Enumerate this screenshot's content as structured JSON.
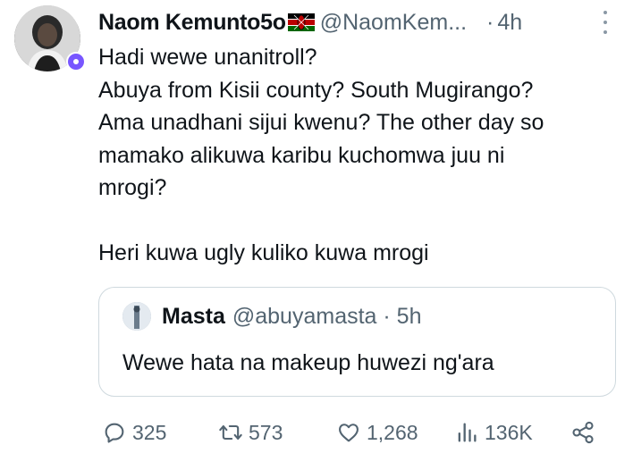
{
  "tweet": {
    "author_name": "Naom Kemunto5o",
    "author_handle": "@NaomKem...",
    "separator": "·",
    "time": "4h",
    "text_lines": [
      "Hadi wewe unanitroll?",
      "Abuya from Kisii county? South Mugirango?",
      "Ama unadhani sijui kwenu? The other day so",
      "mamako alikuwa karibu kuchomwa juu ni",
      "mrogi?",
      "",
      "Heri kuwa ugly kuliko kuwa mrogi"
    ]
  },
  "quote": {
    "author_name": "Masta",
    "author_handle": "@abuyamasta · 5h",
    "text": "Wewe hata na makeup huwezi ng'ara"
  },
  "actions": {
    "replies": "325",
    "retweets": "573",
    "likes": "1,268",
    "views": "136K"
  },
  "icons": [
    "more-icon",
    "reply-icon",
    "retweet-icon",
    "like-icon",
    "views-icon",
    "share-icon",
    "kenya-flag-icon"
  ],
  "colors": {
    "text": "#0f1419",
    "muted": "#536471",
    "border": "#cfd9de",
    "badge": "#7856ff"
  }
}
